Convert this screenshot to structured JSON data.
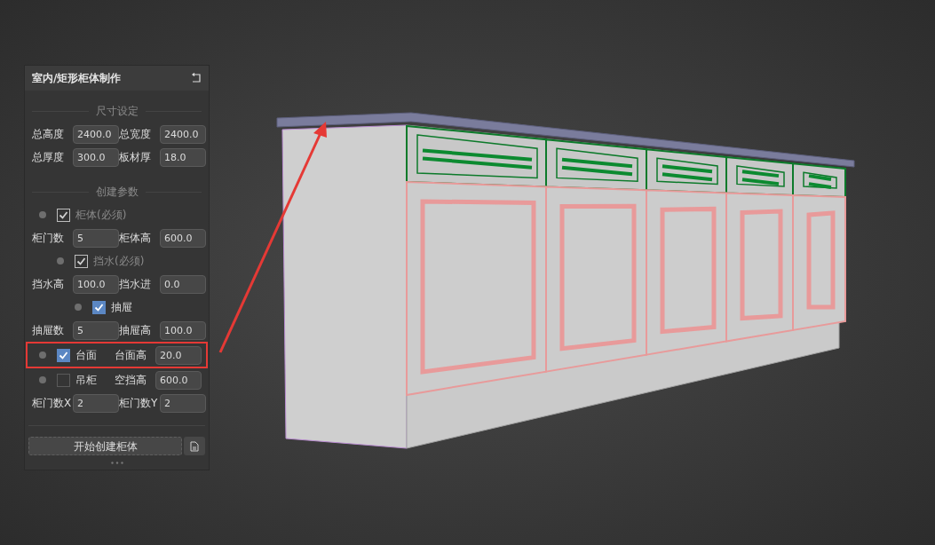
{
  "panel": {
    "title": "室内/矩形柜体制作",
    "size_section": {
      "title": "尺寸设定",
      "rows": [
        [
          {
            "label": "总高度",
            "value": "2400.0"
          },
          {
            "label": "总宽度",
            "value": "2400.0"
          }
        ],
        [
          {
            "label": "总厚度",
            "value": "300.0"
          },
          {
            "label": "板材厚",
            "value": "18.0"
          }
        ]
      ]
    },
    "create_section": {
      "title": "创建参数",
      "items": [
        {
          "kind": "toggle",
          "label": "柜体(必须)",
          "checked": true,
          "disabled": true,
          "children": [
            {
              "kind": "fields",
              "fields": [
                {
                  "label": "柜门数",
                  "value": "5"
                },
                {
                  "label": "柜体高",
                  "value": "600.0"
                }
              ]
            },
            {
              "kind": "toggle",
              "label": "挡水(必须)",
              "checked": true,
              "disabled": true,
              "children": [
                {
                  "kind": "fields",
                  "fields": [
                    {
                      "label": "挡水高",
                      "value": "100.0"
                    },
                    {
                      "label": "挡水进",
                      "value": "0.0"
                    }
                  ]
                },
                {
                  "kind": "toggle",
                  "label": "抽屉",
                  "checked": true,
                  "disabled": false,
                  "children": [
                    {
                      "kind": "fields",
                      "fields": [
                        {
                          "label": "抽屉数",
                          "value": "5"
                        },
                        {
                          "label": "抽屉高",
                          "value": "100.0"
                        }
                      ]
                    }
                  ]
                }
              ]
            }
          ]
        },
        {
          "kind": "toggle",
          "label": "台面",
          "checked": true,
          "disabled": false,
          "highlighted": true,
          "field": {
            "label": "台面高",
            "value": "20.0"
          }
        },
        {
          "kind": "toggle",
          "label": "吊柜",
          "checked": false,
          "disabled": false,
          "field": {
            "label": "空挡高",
            "value": "600.0"
          }
        },
        {
          "kind": "fields",
          "fields": [
            {
              "label": "柜门数X",
              "value": "2"
            },
            {
              "label": "柜门数Y",
              "value": "2"
            }
          ]
        }
      ]
    },
    "create_button": "开始创建柜体"
  }
}
